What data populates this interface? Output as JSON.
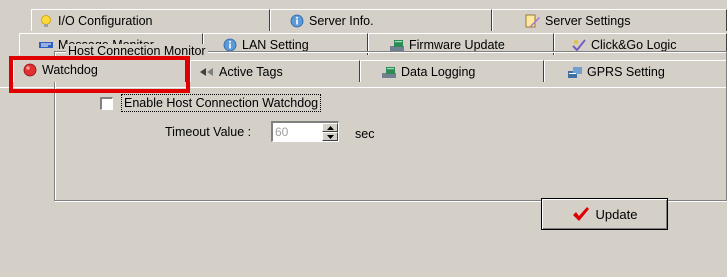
{
  "tabs": {
    "row1": [
      {
        "label": "I/O Configuration",
        "icon": "lightbulb-icon"
      },
      {
        "label": "Server Info.",
        "icon": "info-icon"
      },
      {
        "label": "Server Settings",
        "icon": "server-settings-icon"
      }
    ],
    "row2": [
      {
        "label": "Message Monitor",
        "icon": "message-monitor-icon"
      },
      {
        "label": "LAN Setting",
        "icon": "info-icon"
      },
      {
        "label": "Firmware Update",
        "icon": "firmware-update-icon"
      },
      {
        "label": "Click&Go Logic",
        "icon": "logic-icon"
      }
    ],
    "row3": [
      {
        "label": "Watchdog",
        "icon": "watchdog-icon",
        "selected": true
      },
      {
        "label": "Active Tags",
        "icon": "active-tags-icon"
      },
      {
        "label": "Data Logging",
        "icon": "data-logging-icon"
      },
      {
        "label": "GPRS Setting",
        "icon": "gprs-icon"
      }
    ]
  },
  "group": {
    "title": "Host Connection Monitor"
  },
  "watchdog_checkbox": {
    "label": "Enable Host Connection Watchdog",
    "checked": false
  },
  "timeout": {
    "label": "Timeout Value :",
    "value": "60",
    "unit": "sec"
  },
  "update_button": {
    "label": "Update",
    "icon": "checkmark-icon"
  },
  "colors": {
    "dialog_bg": "#d4d0c8",
    "highlight": "#e00000",
    "checkmark": "#e00000"
  }
}
